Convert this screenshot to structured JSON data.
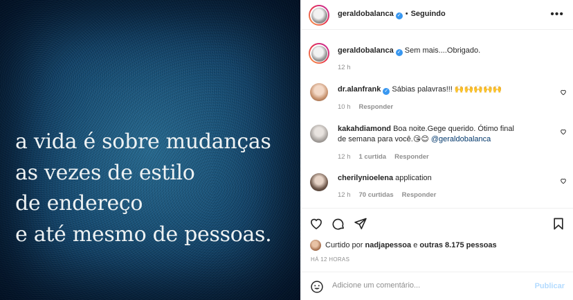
{
  "post_image": {
    "quote_lines": [
      "a vida é sobre mudanças",
      "as vezes de estilo",
      "de endereço",
      "e até mesmo de pessoas."
    ]
  },
  "header": {
    "username": "geraldobalanca",
    "separator": "•",
    "follow_status": "Seguindo",
    "more_label": "•••"
  },
  "caption": {
    "username": "geraldobalanca",
    "text": "Sem mais....Obrigado.",
    "time": "12 h"
  },
  "comments": [
    {
      "username": "dr.alanfrank",
      "verified": true,
      "text": "Sábias palavras!!! 🙌🙌🙌🙌🙌",
      "time": "10 h",
      "likes": "",
      "reply_label": "Responder"
    },
    {
      "username": "kakahdiamond",
      "verified": false,
      "text": "Boa noite.Gege querido. Ótimo final de semana para você.😘😊 ",
      "mention": "@geraldobalanca",
      "time": "12 h",
      "likes": "1 curtida",
      "reply_label": "Responder"
    },
    {
      "username": "cherilynioelena",
      "verified": false,
      "text": "application",
      "time": "12 h",
      "likes": "70 curtidas",
      "reply_label": "Responder"
    }
  ],
  "likes": {
    "prefix": "Curtido por",
    "user": "nadjapessoa",
    "conjunction": "e",
    "others": "outras 8.175 pessoas"
  },
  "time_ago": "HÁ 12 HORAS",
  "comment_box": {
    "placeholder": "Adicione um comentário...",
    "publish_label": "Publicar"
  },
  "colors": {
    "verified": "#3897f0",
    "publish_disabled": "#b3dbff",
    "mention": "#00376b",
    "meta_gray": "#8e8e8e"
  },
  "icons": {
    "like": "heart-icon",
    "comment": "comment-icon",
    "share": "paper-plane-icon",
    "save": "bookmark-icon",
    "emoji": "smiley-icon",
    "more": "ellipsis-icon"
  }
}
